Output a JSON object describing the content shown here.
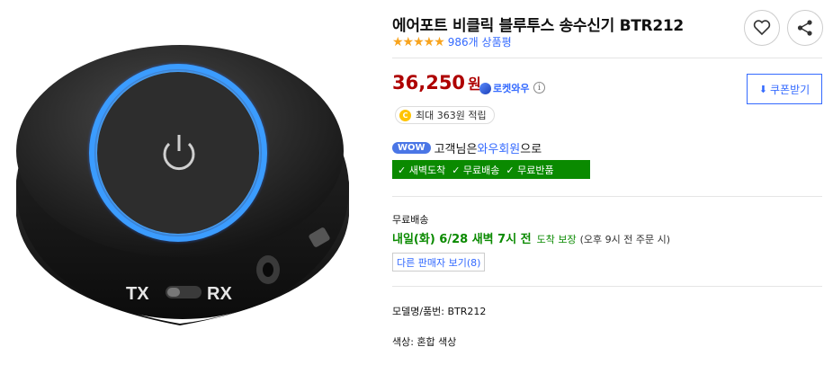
{
  "product": {
    "title": "에어포트 비클릭 블루투스 송수신기 BTR212",
    "stars": "★★★★★",
    "review_count": "986개 상품평"
  },
  "price": {
    "amount": "36,250",
    "unit": "원",
    "rocket_label": "로켓와우",
    "info_symbol": "i"
  },
  "coupon": {
    "label": "쿠폰받기",
    "icon": "download-icon"
  },
  "cashback": {
    "coin": "C",
    "text": "최대 363원 적립"
  },
  "wow": {
    "badge": "WOW",
    "prefix": "고객님은 ",
    "member": "와우회원",
    "suffix": "으로"
  },
  "delivery_tags": [
    "✓ 새벽도착",
    "✓ 무료배송",
    "✓ 무료반품"
  ],
  "shipping": {
    "label": "무료배송",
    "date": "내일(화) 6/28 새벽 7시 전",
    "guarantee": "도착 보장",
    "note": "(오후 9시 전 주문 시)"
  },
  "other_sellers": "다른 판매자 보기(8)",
  "specs": {
    "model": "모델명/품번: BTR212",
    "color": "색상: 혼합 색상"
  },
  "device_labels": {
    "tx": "TX",
    "rx": "RX"
  },
  "colors": {
    "price_red": "#ae0000",
    "link_blue": "#346aff",
    "delivery_green": "#0a8a00",
    "star_orange": "#f8a41e"
  }
}
